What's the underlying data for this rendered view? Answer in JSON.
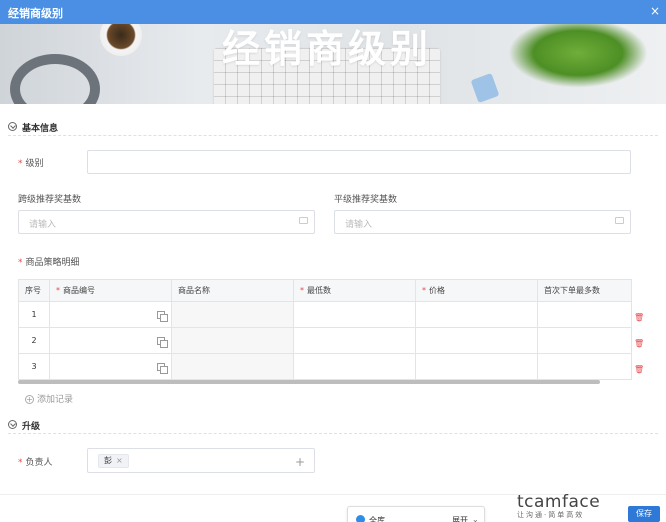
{
  "dialog": {
    "title": "经销商级别",
    "close": "×"
  },
  "banner": {
    "text": "经销商级别"
  },
  "sections": {
    "basic": "基本信息",
    "upgrade": "升级"
  },
  "form": {
    "level_label": "级别",
    "level_value": "",
    "cross_bonus_label": "跨级推荐奖基数",
    "cross_bonus_placeholder": "请输入",
    "flat_bonus_label": "平级推荐奖基数",
    "flat_bonus_placeholder": "请输入",
    "strategy_label": "商品策略明细",
    "owner_label": "负责人",
    "owner_tag": "彭",
    "owner_tag_remove": "×",
    "owner_add": "+"
  },
  "table": {
    "headers": [
      "序号",
      "商品编号",
      "商品名称",
      "最低数",
      "价格",
      "首次下单最多数"
    ],
    "required_cols": [
      1,
      3,
      4
    ],
    "rows": [
      {
        "idx": "1"
      },
      {
        "idx": "2"
      },
      {
        "idx": "3"
      }
    ],
    "add_label": "添加记录"
  },
  "footer": {
    "popup_label": "全库",
    "popup_toggle": "展开",
    "watermark": "tcamface",
    "watermark_sub": "让沟通·简单高效",
    "save": "保存"
  },
  "colors": {
    "accent": "#4a8fe3",
    "required": "#e5484d"
  }
}
